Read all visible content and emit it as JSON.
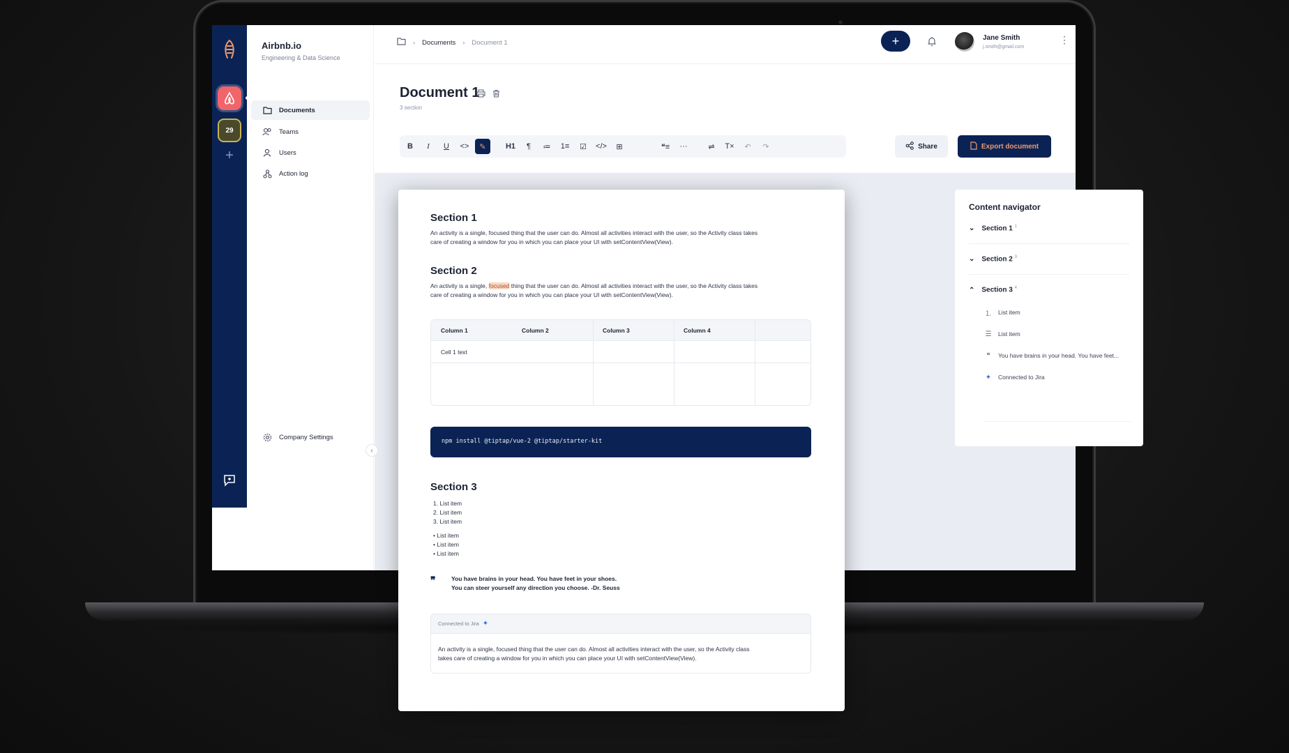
{
  "sidebar": {
    "brand_name": "Airbnb.io",
    "brand_sub": "Engineering & Data Science",
    "calendar_badge_day": "29",
    "nav": [
      {
        "label": "Documents"
      },
      {
        "label": "Teams"
      },
      {
        "label": "Users"
      },
      {
        "label": "Action log"
      }
    ],
    "settings_label": "Company Settings"
  },
  "topbar": {
    "breadcrumb_root": "Documents",
    "breadcrumb_current": "Document 1",
    "user_name": "Jane Smith",
    "user_email": "j.smith@gmail.com"
  },
  "document": {
    "title": "Document 1",
    "subtitle": "3 section",
    "share_label": "Share",
    "export_label": "Export document"
  },
  "toolbar": {
    "items": [
      "B",
      "I",
      "U",
      "<>",
      "✎",
      "H1",
      "¶",
      "≔",
      "1≡",
      "☑",
      "</>",
      "⊞",
      "❝≡",
      "···",
      "⇌",
      "T×",
      "↶",
      "↷"
    ]
  },
  "content": {
    "section1_title": "Section 1",
    "section1_text_line1": "An activity is a single, focused thing that the user can do. Almost all activities interact with the user, so the Activity class takes",
    "section1_text_line2": "care of creating a window for you in which you can place your UI with setContentView(View).",
    "section2_title": "Section 2",
    "section2_text_pre": "An activity is a single, ",
    "section2_text_highlight": "focused",
    "section2_text_post": " thing that the user can do. Almost all activities interact with the user, so the Activity class takes",
    "section2_text_line2": "care of creating a window for you in which you can place your UI with setContentView(View).",
    "table": {
      "headers": [
        "Column 1",
        "Column 2",
        "Column 3",
        "Column 4"
      ],
      "cell_1": "Cell 1 text"
    },
    "code": "npm install @tiptap/vue-2 @tiptap/starter-kit",
    "section3_title": "Section 3",
    "ordered_list": [
      "1. List item",
      "2. List item",
      "3. List item"
    ],
    "bullet_list": [
      "• List item",
      "• List item",
      "• List item"
    ],
    "quote_line1": "You have brains in your head. You have feet in your shoes.",
    "quote_line2": "You can steer yourself any direction you choose. -Dr. Seuss",
    "jira_label": "Connected to Jira",
    "jira_text_line1": "An activity is a single, focused thing that the user can do. Almost all activities interact with the user, so the Activity class",
    "jira_text_line2": "takes care of creating a window for you in which you can place your UI with setContentView(View)."
  },
  "navigator": {
    "title": "Content navigator",
    "sections": [
      {
        "label": "Section 1",
        "count": "1"
      },
      {
        "label": "Section 2",
        "count": "3"
      },
      {
        "label": "Section 3",
        "count": "4"
      }
    ],
    "items": [
      {
        "label": "List item"
      },
      {
        "label": "List item"
      },
      {
        "label": "You have brains in your head. You have feet..."
      },
      {
        "label": "Connected to Jira"
      }
    ]
  },
  "colors": {
    "navy": "#0b2354",
    "accent": "#f19a6b",
    "airbnb": "#f0646a"
  }
}
